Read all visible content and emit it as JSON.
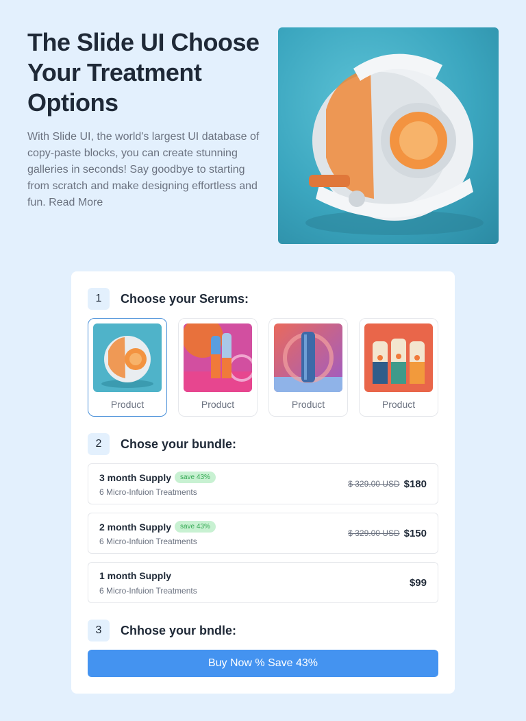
{
  "hero": {
    "title": "The Slide UI Choose Your Treatment Options",
    "description": "With Slide UI, the world's largest UI database of copy-paste blocks, you can create stunning galleries in seconds! Say goodbye to starting from scratch and make designing effortless and fun.  Read More"
  },
  "steps": [
    {
      "number": "1",
      "title": "Choose your Serums:"
    },
    {
      "number": "2",
      "title": "Chose your bundle:"
    },
    {
      "number": "3",
      "title": "Chhose your bndle:"
    }
  ],
  "products": [
    {
      "label": "Product",
      "selected": true
    },
    {
      "label": "Product",
      "selected": false
    },
    {
      "label": "Product",
      "selected": false
    },
    {
      "label": "Product",
      "selected": false
    }
  ],
  "bundles": [
    {
      "name": "3 month Supply",
      "badge": "save 43%",
      "subtitle": "6 Micro-Infuion Treatments",
      "old_price": "$ 329.00 USD",
      "price": "$180"
    },
    {
      "name": "2 month Supply",
      "badge": "save 43%",
      "subtitle": "6 Micro-Infuion Treatments",
      "old_price": "$ 329.00 USD",
      "price": "$150"
    },
    {
      "name": "1 month Supply",
      "subtitle": "6 Micro-Infuion Treatments",
      "price": "$99"
    }
  ],
  "buy_button": "Buy Now % Save 43%",
  "colors": {
    "page_bg": "#e3f0fd",
    "accent": "#4493f0",
    "selected_border": "#4a90d9",
    "badge_bg": "#c8f1d2",
    "badge_text": "#34a853"
  }
}
